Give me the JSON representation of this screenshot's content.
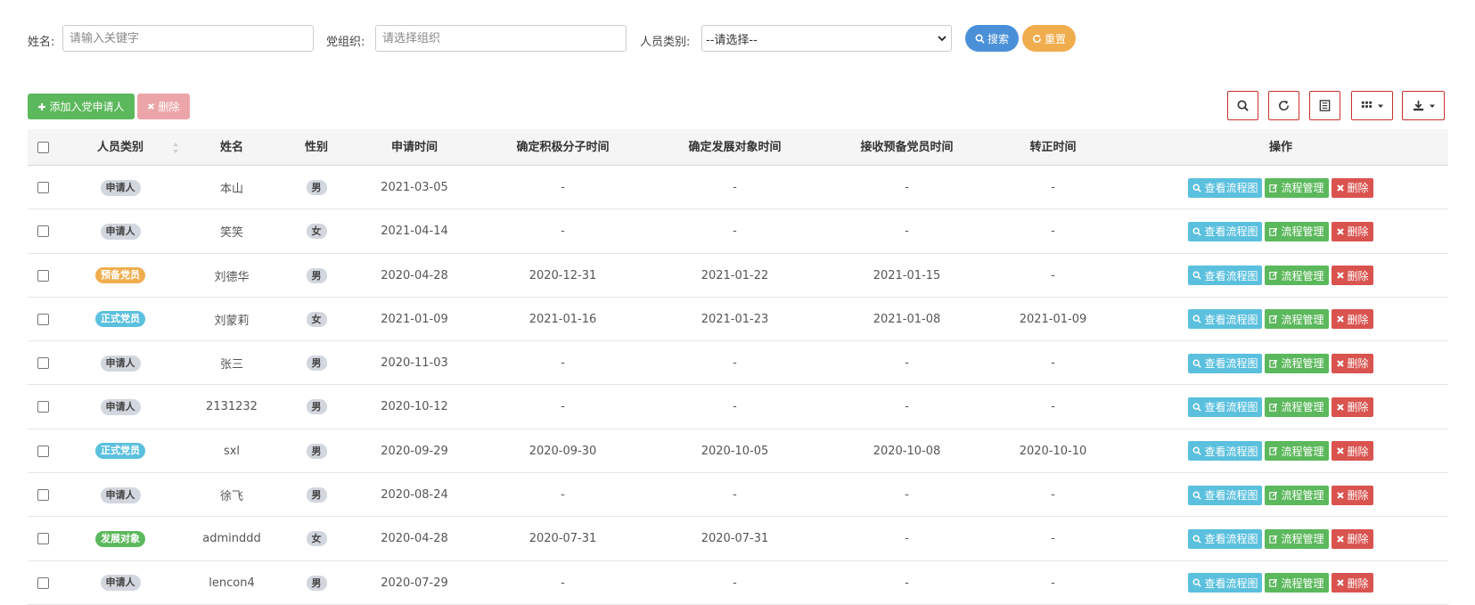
{
  "search": {
    "name_label": "姓名:",
    "name_placeholder": "请输入关键字",
    "org_label": "党组织:",
    "org_placeholder": "请选择组织",
    "type_label": "人员类别:",
    "type_selected": "--请选择--",
    "search_btn": "搜索",
    "reset_btn": "重置"
  },
  "toolbar": {
    "add_btn": "添加入党申请人",
    "delete_btn": "删除"
  },
  "colors": {
    "primary": "#4a90d9",
    "warning": "#f0ad4e",
    "success": "#5cb85c",
    "danger": "#d9534f",
    "info": "#5bc0de",
    "gray": "#d2d6de"
  },
  "table": {
    "headers": [
      "人员类别",
      "姓名",
      "性别",
      "申请时间",
      "确定积极分子时间",
      "确定发展对象时间",
      "接收预备党员时间",
      "转正时间",
      "操作"
    ],
    "action_labels": {
      "view": "查看流程图",
      "manage": "流程管理",
      "delete": "删除"
    },
    "rows": [
      {
        "type": "申请人",
        "type_style": "gray",
        "name": "本山",
        "sex": "男",
        "apply": "2021-03-05",
        "active": "-",
        "develop": "-",
        "prep": "-",
        "formal": "-"
      },
      {
        "type": "申请人",
        "type_style": "gray",
        "name": "笑笑",
        "sex": "女",
        "apply": "2021-04-14",
        "active": "-",
        "develop": "-",
        "prep": "-",
        "formal": "-"
      },
      {
        "type": "预备党员",
        "type_style": "warning",
        "name": "刘德华",
        "sex": "男",
        "apply": "2020-04-28",
        "active": "2020-12-31",
        "develop": "2021-01-22",
        "prep": "2021-01-15",
        "formal": "-"
      },
      {
        "type": "正式党员",
        "type_style": "info",
        "name": "刘蒙莉",
        "sex": "女",
        "apply": "2021-01-09",
        "active": "2021-01-16",
        "develop": "2021-01-23",
        "prep": "2021-01-08",
        "formal": "2021-01-09"
      },
      {
        "type": "申请人",
        "type_style": "gray",
        "name": "张三",
        "sex": "男",
        "apply": "2020-11-03",
        "active": "-",
        "develop": "-",
        "prep": "-",
        "formal": "-"
      },
      {
        "type": "申请人",
        "type_style": "gray",
        "name": "2131232",
        "sex": "男",
        "apply": "2020-10-12",
        "active": "-",
        "develop": "-",
        "prep": "-",
        "formal": "-"
      },
      {
        "type": "正式党员",
        "type_style": "info",
        "name": "sxl",
        "sex": "男",
        "apply": "2020-09-29",
        "active": "2020-09-30",
        "develop": "2020-10-05",
        "prep": "2020-10-08",
        "formal": "2020-10-10"
      },
      {
        "type": "申请人",
        "type_style": "gray",
        "name": "徐飞",
        "sex": "男",
        "apply": "2020-08-24",
        "active": "-",
        "develop": "-",
        "prep": "-",
        "formal": "-"
      },
      {
        "type": "发展对象",
        "type_style": "success",
        "name": "adminddd",
        "sex": "女",
        "apply": "2020-04-28",
        "active": "2020-07-31",
        "develop": "2020-07-31",
        "prep": "-",
        "formal": "-"
      },
      {
        "type": "申请人",
        "type_style": "gray",
        "name": "lencon4",
        "sex": "男",
        "apply": "2020-07-29",
        "active": "-",
        "develop": "-",
        "prep": "-",
        "formal": "-"
      }
    ]
  }
}
